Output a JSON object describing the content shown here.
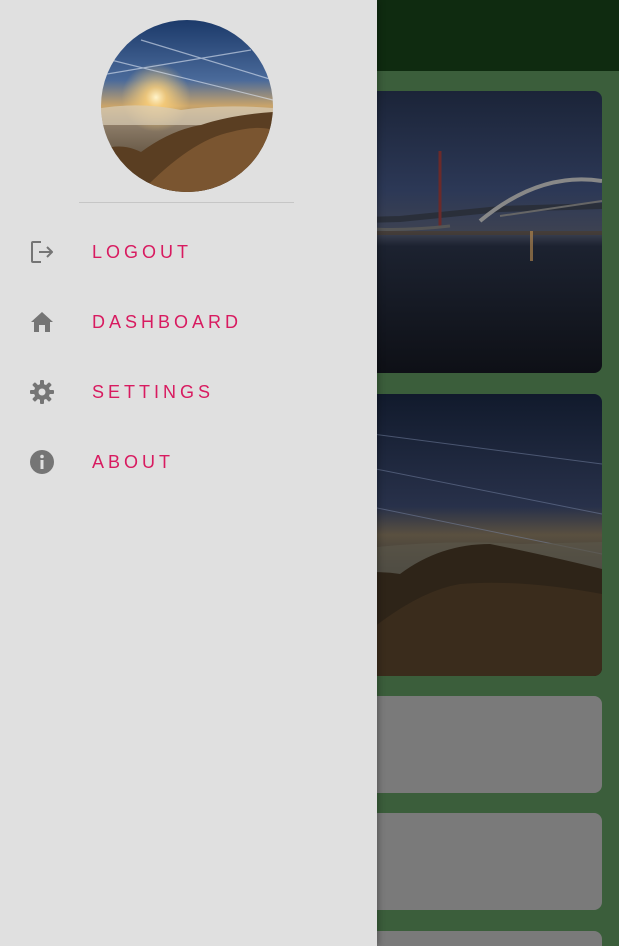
{
  "drawer": {
    "profile_image": "profile-landscape-photo",
    "menu": [
      {
        "label": "LOGOUT",
        "icon": "logout-icon"
      },
      {
        "label": "DASHBOARD",
        "icon": "home-icon"
      },
      {
        "label": "SETTINGS",
        "icon": "gear-icon"
      },
      {
        "label": "ABOUT",
        "icon": "info-icon"
      }
    ]
  },
  "colors": {
    "accent": "#d81b60",
    "drawer_bg": "#e0e0e0",
    "appbar": "#0f2b10",
    "app_bg": "#3b5e3b",
    "icon": "#757575"
  }
}
